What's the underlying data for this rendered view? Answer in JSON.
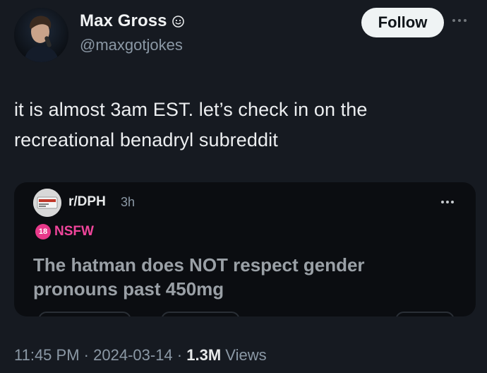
{
  "author": {
    "display_name": "Max Gross",
    "handle": "@maxgotjokes",
    "badge_icon": "smiley-face-icon"
  },
  "follow_button": {
    "label": "Follow"
  },
  "tweet": {
    "text_line1": "it is almost 3am EST. let’s check in on the",
    "text_line2": "recreational benadryl subreddit"
  },
  "quoted_post": {
    "subreddit": "r/DPH",
    "age": "3h",
    "nsfw_badge_number": "18",
    "nsfw_label": "NSFW",
    "title_line1": "The hatman does NOT respect gender",
    "title_line2": "pronouns past 450mg"
  },
  "meta": {
    "time": "11:45 PM",
    "separator": "·",
    "date": "2024-03-14",
    "views_count": "1.3M",
    "views_label": "Views"
  },
  "colors": {
    "background": "#161a21",
    "card_background": "#0b0d11",
    "nsfw_accent": "#e8398a",
    "secondary_text": "#8b98a5"
  }
}
